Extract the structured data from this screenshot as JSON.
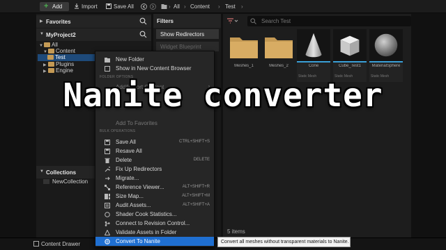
{
  "toolbar": {
    "add_label": "Add",
    "import_label": "Import",
    "save_all_label": "Save All",
    "breadcrumb": [
      "All",
      "Content",
      "Test"
    ]
  },
  "favorites": {
    "title": "Favorites"
  },
  "project": {
    "title": "MyProject2",
    "tree": [
      "All",
      "Content",
      "Test",
      "Plugins",
      "Engine"
    ]
  },
  "collections": {
    "title": "Collections",
    "items": [
      "NewCollection"
    ]
  },
  "filters": {
    "title": "Filters",
    "items": [
      "Show Redirectors",
      "Widget Blueprint"
    ]
  },
  "search": {
    "placeholder": "Search Test"
  },
  "assets": [
    {
      "name": "Meshes_1",
      "sub": "",
      "kind": "folder"
    },
    {
      "name": "Meshes_2",
      "sub": "",
      "kind": "folder"
    },
    {
      "name": "Cone",
      "sub": "Static Mesh",
      "kind": "cone"
    },
    {
      "name": "Cube_Test1",
      "sub": "Static Mesh",
      "kind": "cube"
    },
    {
      "name": "MaterialSphere",
      "sub": "Static Mesh",
      "kind": "sphere"
    }
  ],
  "items_count": "5 items",
  "bottom": {
    "content_drawer": "Content Drawer"
  },
  "context_menu": {
    "sections": {
      "operations": "FOLDER OPTIONS",
      "bulk": "BULK OPERATIONS"
    },
    "items": [
      {
        "label": "New Folder",
        "shortcut": "",
        "dim": false
      },
      {
        "label": "Show in New Content Browser",
        "shortcut": "",
        "dim": false
      },
      {
        "label": "Add/Import Content",
        "shortcut": "",
        "dim": true
      },
      {
        "label": "Add To Favorites",
        "shortcut": "",
        "dim": true
      },
      {
        "label": "Save All",
        "shortcut": "CTRL+SHIFT+S",
        "dim": false
      },
      {
        "label": "Resave All",
        "shortcut": "",
        "dim": false
      },
      {
        "label": "Delete",
        "shortcut": "DELETE",
        "dim": false
      },
      {
        "label": "Fix Up Redirectors",
        "shortcut": "",
        "dim": false
      },
      {
        "label": "Migrate...",
        "shortcut": "",
        "dim": false
      },
      {
        "label": "Reference Viewer...",
        "shortcut": "ALT+SHIFT+R",
        "dim": false
      },
      {
        "label": "Size Map...",
        "shortcut": "ALT+SHIFT+M",
        "dim": false
      },
      {
        "label": "Audit Assets...",
        "shortcut": "ALT+SHIFT+A",
        "dim": false
      },
      {
        "label": "Shader Cook Statistics...",
        "shortcut": "",
        "dim": false
      },
      {
        "label": "Connect to Revision Control...",
        "shortcut": "",
        "dim": false
      },
      {
        "label": "Validate Assets in Folder",
        "shortcut": "",
        "dim": false
      },
      {
        "label": "Convert To Nanite",
        "shortcut": "",
        "dim": false
      }
    ]
  },
  "tooltip": "Convert all meshes without transparent materials to Nanite.",
  "overlay_title": "Nanite converter",
  "colors": {
    "accent": "#1f6fd1",
    "selection": "#1e4a7a",
    "add_plus": "#4caf50"
  }
}
